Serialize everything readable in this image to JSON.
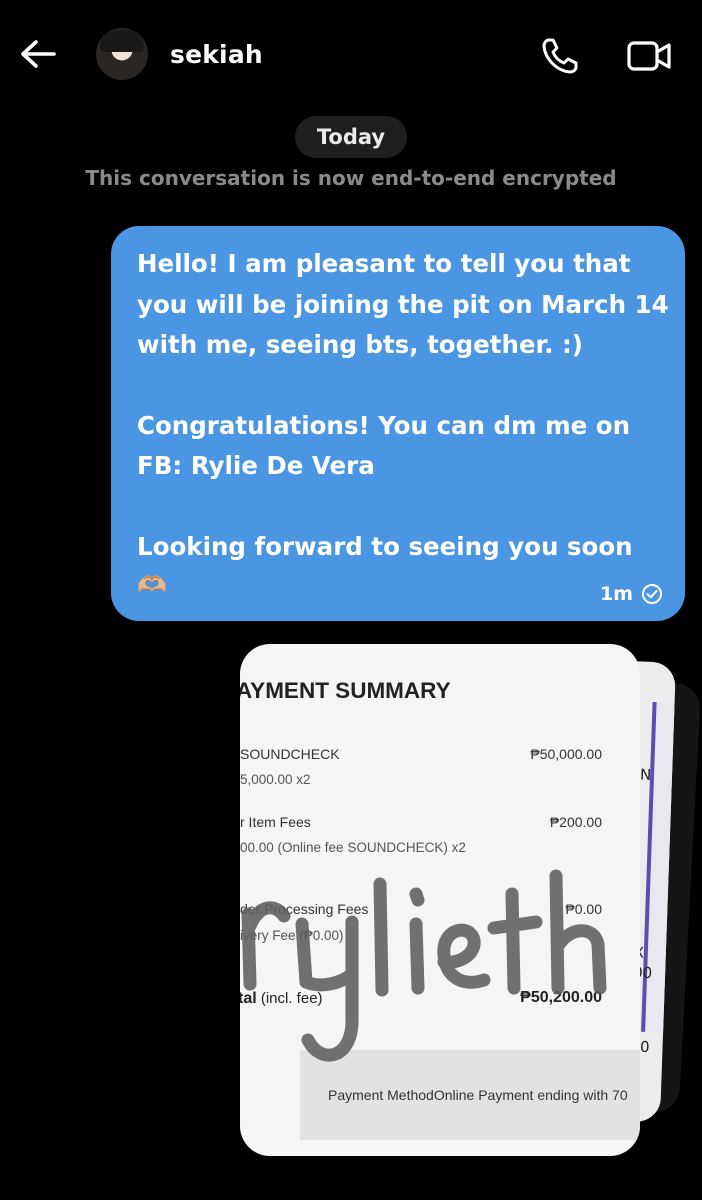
{
  "header": {
    "contact_name": "sekiah",
    "back_icon": "arrow-left-icon",
    "call_icon": "phone-icon",
    "video_icon": "video-camera-icon"
  },
  "conversation": {
    "date_label": "Today",
    "encryption_notice": "This conversation is now end-to-end encrypted"
  },
  "message": {
    "lines_p1": [
      "Hello! I am pleasant to tell you that",
      "you will be joining the pit on March 14",
      "with me, seeing bts, together. :)"
    ],
    "lines_p2": [
      "Congratulations! You can dm me on",
      "FB: Rylie De Vera"
    ],
    "lines_p3": [
      "Looking forward to seeing you soon"
    ],
    "emoji": "🫶🏼",
    "time": "1m",
    "status_icon": "check-circle-icon",
    "bubble_color": "#4a96e3"
  },
  "attachment": {
    "title": "AYMENT SUMMARY",
    "items": [
      {
        "label": "SOUNDCHECK",
        "detail": "5,000.00 x2",
        "amount": "₱50,000.00"
      },
      {
        "label": "r Item Fees",
        "detail": "00.00 (Online fee SOUNDCHECK) x2",
        "amount": "₱200.00"
      },
      {
        "label": "der Processing Fees",
        "detail": "ivery Fee (₱0.00)",
        "amount": "₱0.00"
      }
    ],
    "total_label": "tal",
    "total_note": "(incl. fee)",
    "total_amount": "₱50,200.00",
    "payment_method": "Payment MethodOnline Payment ending with 70",
    "watermark": "rylieth",
    "back_card_glyphs": [
      "N",
      "X",
      "00",
      "00"
    ]
  }
}
